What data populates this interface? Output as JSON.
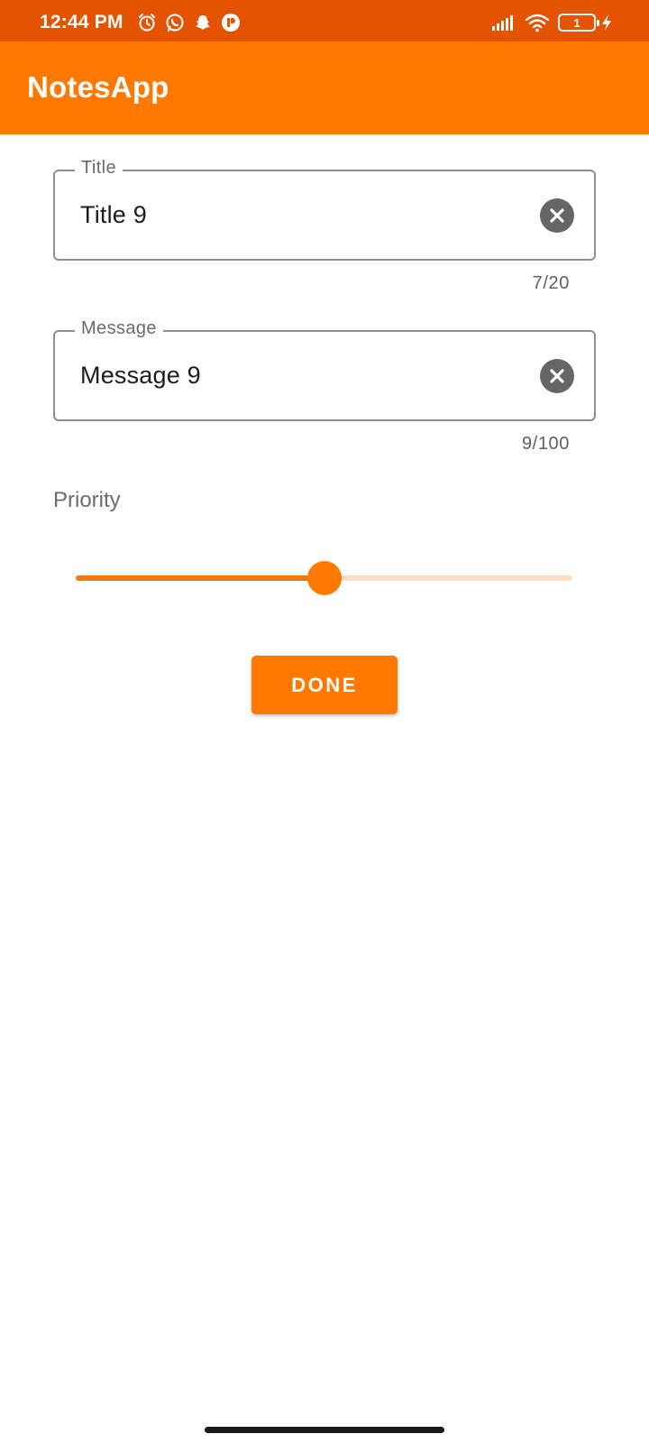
{
  "status_bar": {
    "time": "12:44 PM",
    "left_icons": [
      "alarm-icon",
      "whatsapp-icon",
      "snapchat-icon",
      "app-notification-icon"
    ],
    "right_icons": [
      "signal-icon",
      "wifi-icon",
      "battery-icon",
      "charging-icon"
    ],
    "battery_level": "1"
  },
  "app_bar": {
    "title": "NotesApp"
  },
  "form": {
    "title_field": {
      "label": "Title",
      "value": "Title 9",
      "counter": "7/20",
      "clear_icon": "clear-icon"
    },
    "message_field": {
      "label": "Message",
      "value": "Message 9",
      "counter": "9/100",
      "clear_icon": "clear-icon"
    },
    "priority": {
      "label": "Priority",
      "slider_fraction": 0.5
    },
    "done_label": "DONE"
  },
  "colors": {
    "status_bar": "#E45300",
    "app_bar": "#FF7800",
    "accent": "#FF7800",
    "slider_inactive": "#FDDDC2",
    "clear_icon_bg": "#666666"
  }
}
